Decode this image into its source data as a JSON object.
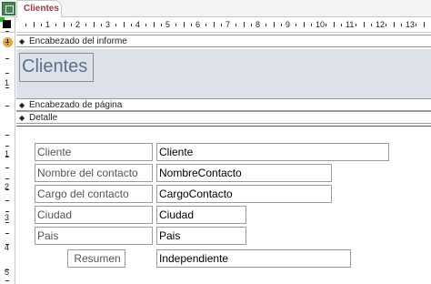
{
  "tab": {
    "title": "Clientes"
  },
  "ruler": {
    "horizontal_numbers": [
      "1",
      "2",
      "3",
      "4",
      "5",
      "6",
      "7",
      "8",
      "9",
      "10",
      "11",
      "12",
      "13"
    ],
    "vertical_numbers": [
      "1",
      "1",
      "2",
      "3",
      "4",
      "5"
    ]
  },
  "sections": {
    "report_header": "Encabezado del informe",
    "page_header": "Encabezado de página",
    "detail": "Detalle"
  },
  "report_title": "Clientes",
  "detail": {
    "rows": [
      {
        "label": "Cliente",
        "field": "Cliente"
      },
      {
        "label": "Nombre del contacto",
        "field": "NombreContacto"
      },
      {
        "label": "Cargo del contacto",
        "field": "CargoContacto"
      },
      {
        "label": "Ciudad",
        "field": "Ciudad"
      },
      {
        "label": "Pais",
        "field": "Pais"
      },
      {
        "label": "Resumen",
        "field": "Independiente"
      }
    ]
  },
  "colors": {
    "header_background": "#dde1ea",
    "title_text": "#5c6f8c",
    "tab_text": "#a4373a"
  }
}
